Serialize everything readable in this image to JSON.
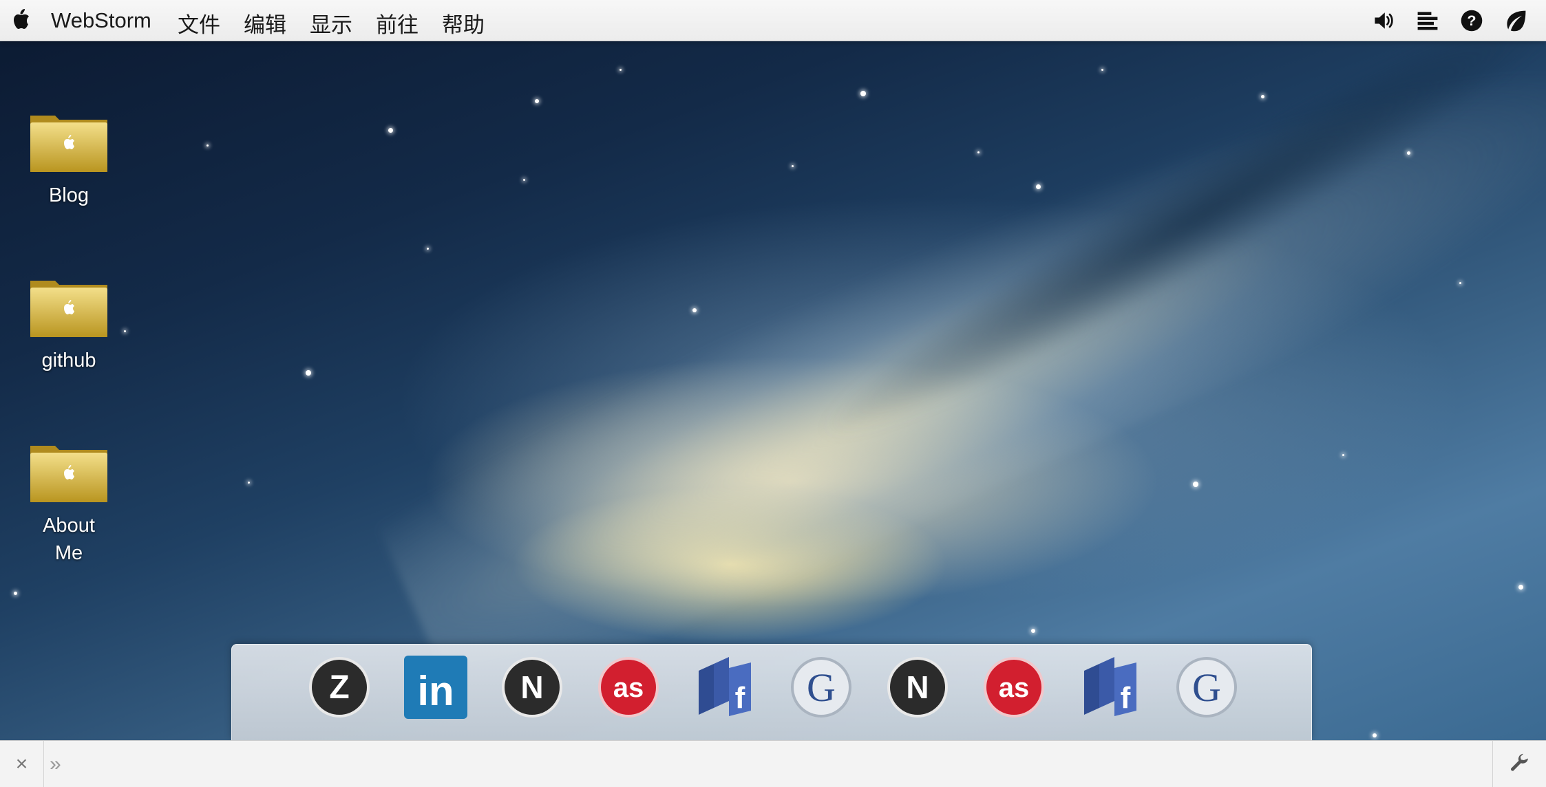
{
  "menubar": {
    "app_name": "WebStorm",
    "items": [
      {
        "label": "文件"
      },
      {
        "label": "编辑"
      },
      {
        "label": "显示"
      },
      {
        "label": "前往"
      },
      {
        "label": "帮助"
      }
    ],
    "status_icons": [
      "volume-icon",
      "align-icon",
      "help-icon",
      "leaf-icon"
    ]
  },
  "desktop": {
    "folders": [
      {
        "label": "Blog"
      },
      {
        "label": "github"
      },
      {
        "label": "About Me"
      }
    ]
  },
  "dock": {
    "items": [
      {
        "name": "zerply",
        "glyph": "Z",
        "color": "#2b2b2b"
      },
      {
        "name": "linkedin",
        "glyph": "in",
        "color": "#1f7bb6"
      },
      {
        "name": "netvibes",
        "glyph": "N",
        "color": "#2b2b2b"
      },
      {
        "name": "lastfm",
        "glyph": "as",
        "color": "#d21f2f"
      },
      {
        "name": "facebook",
        "glyph": "f",
        "color": "#3b5aa8"
      },
      {
        "name": "google",
        "glyph": "G",
        "color": "#cfd6df"
      },
      {
        "name": "netvibes",
        "glyph": "N",
        "color": "#2b2b2b"
      },
      {
        "name": "lastfm",
        "glyph": "as",
        "color": "#d21f2f"
      },
      {
        "name": "facebook",
        "glyph": "f",
        "color": "#3b5aa8"
      },
      {
        "name": "google",
        "glyph": "G",
        "color": "#cfd6df"
      }
    ]
  },
  "console": {
    "close_glyph": "×",
    "prompt_glyph": "»",
    "input_value": "",
    "tool_icon": "wrench-icon"
  }
}
